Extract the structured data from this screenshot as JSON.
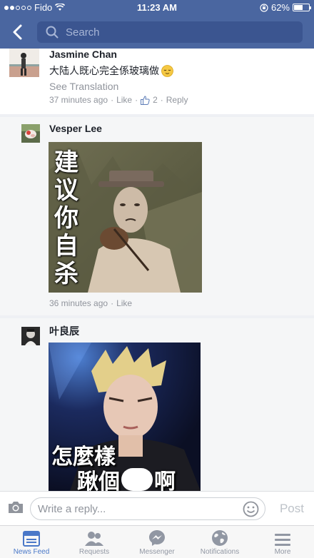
{
  "status_bar": {
    "carrier": "Fido",
    "time": "11:23 AM",
    "battery_percent": "62%",
    "battery_level": 0.62,
    "signal_bars_filled": 2,
    "signal_bars_total": 5
  },
  "nav": {
    "back_icon": "chevron-left-icon",
    "search_placeholder": "Search"
  },
  "comments": [
    {
      "author": "Jasmine Chan",
      "text": "大陆人既心完全係玻璃做",
      "emoji": "relieved-face-emoji",
      "see_translation": "See Translation",
      "time": "37 minutes ago",
      "like_label": "Like",
      "like_count": "2",
      "reply_label": "Reply"
    },
    {
      "author": "Vesper Lee",
      "image_caption": "建议你自杀",
      "time": "36 minutes ago",
      "like_label": "Like"
    },
    {
      "author": "叶良辰",
      "image_caption_line1": "怎麼樣",
      "image_caption_line2": "踿個",
      "image_caption_line3": "啊"
    }
  ],
  "composer": {
    "placeholder": "Write a reply...",
    "post_label": "Post"
  },
  "tabs": [
    {
      "label": "News Feed",
      "icon": "news-feed-icon",
      "active": true
    },
    {
      "label": "Requests",
      "icon": "friends-icon",
      "active": false
    },
    {
      "label": "Messenger",
      "icon": "messenger-icon",
      "active": false
    },
    {
      "label": "Notifications",
      "icon": "globe-icon",
      "active": false
    },
    {
      "label": "More",
      "icon": "menu-icon",
      "active": false
    }
  ],
  "colors": {
    "brand": "#4a66a0",
    "active_tab": "#4a78c8"
  }
}
